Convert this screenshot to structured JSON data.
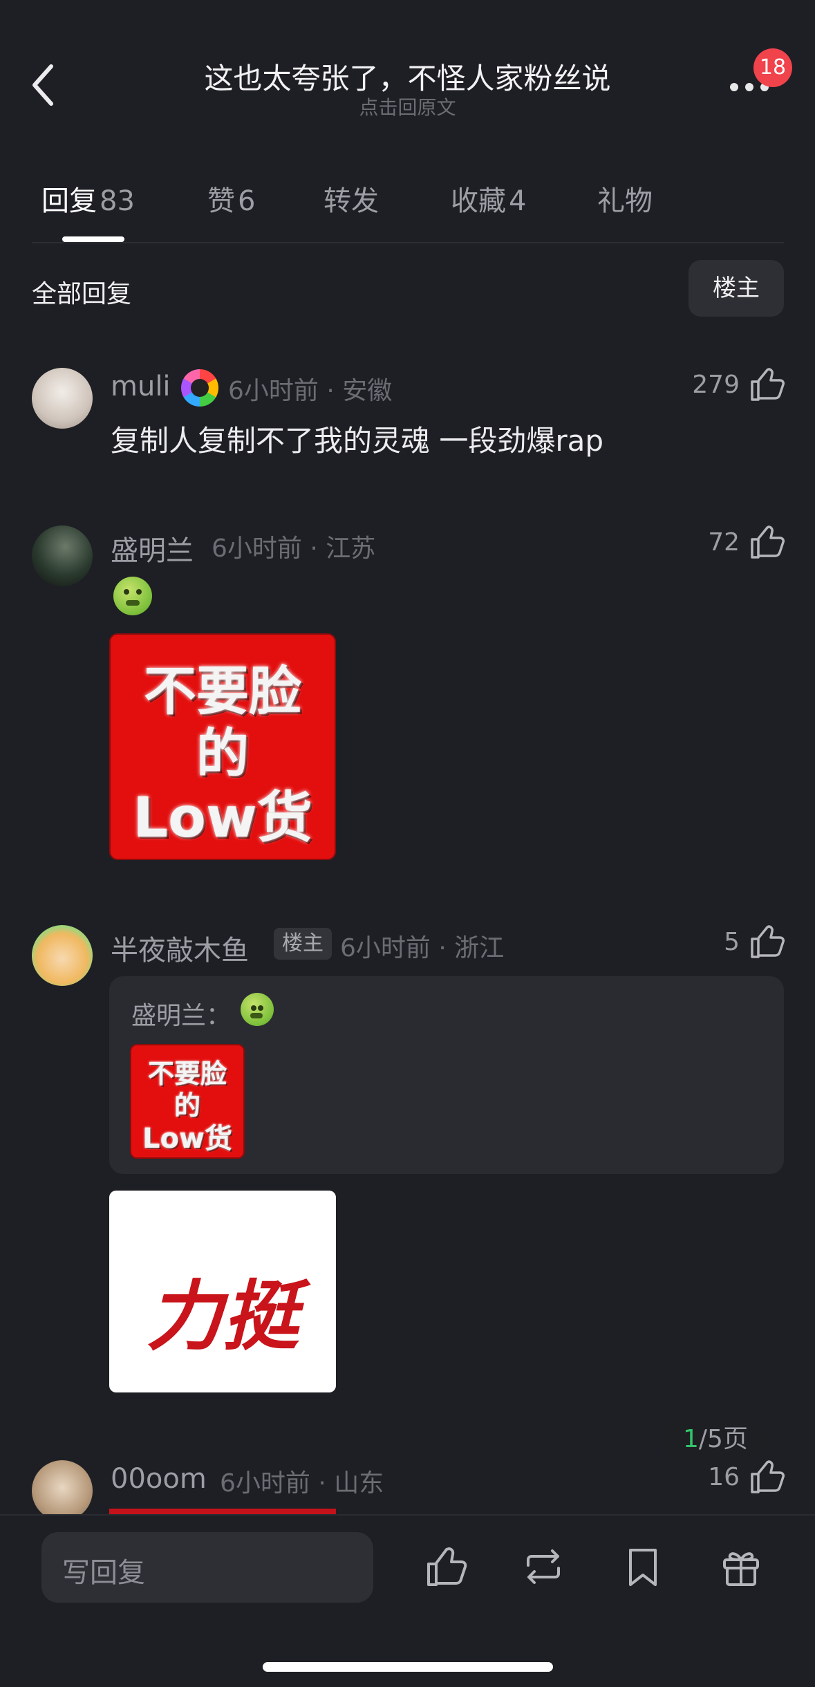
{
  "header": {
    "title": "这也太夸张了，不怪人家粉丝说",
    "subtitle": "点击回原文",
    "notification_count": "18"
  },
  "tabs": [
    {
      "label": "回复",
      "count": "83"
    },
    {
      "label": "赞",
      "count": "6"
    },
    {
      "label": "转发",
      "count": ""
    },
    {
      "label": "收藏",
      "count": "4"
    },
    {
      "label": "礼物",
      "count": ""
    }
  ],
  "filter": {
    "label": "全部回复",
    "button": "楼主"
  },
  "comments": [
    {
      "name": "muli",
      "meta": "6小时前 · 安徽",
      "likes": "279",
      "text": "复制人复制不了我的灵魂 一段劲爆rap"
    },
    {
      "name": "盛明兰",
      "meta": "6小时前 · 江苏",
      "likes": "72",
      "sticker_line1": "不要脸",
      "sticker_line2": "的",
      "sticker_line3": "Low货"
    },
    {
      "name": "半夜敲木鱼",
      "tag": "楼主",
      "meta": "6小时前 · 浙江",
      "likes": "5",
      "quote_name": "盛明兰：",
      "quote_sticker_line1": "不要脸",
      "quote_sticker_line2": "的",
      "quote_sticker_line3": "Low货",
      "sticker_text": "力挺"
    },
    {
      "name": "00oom",
      "meta": "6小时前 · 山东",
      "likes": "16"
    }
  ],
  "pagination": {
    "current": "1",
    "total": "/5页"
  },
  "bottom_bar": {
    "reply_placeholder": "写回复"
  },
  "colors": {
    "background": "#1e1f24",
    "badge": "#f0434c",
    "sticker_red": "#e30f0f",
    "page_current": "#34c36b"
  }
}
